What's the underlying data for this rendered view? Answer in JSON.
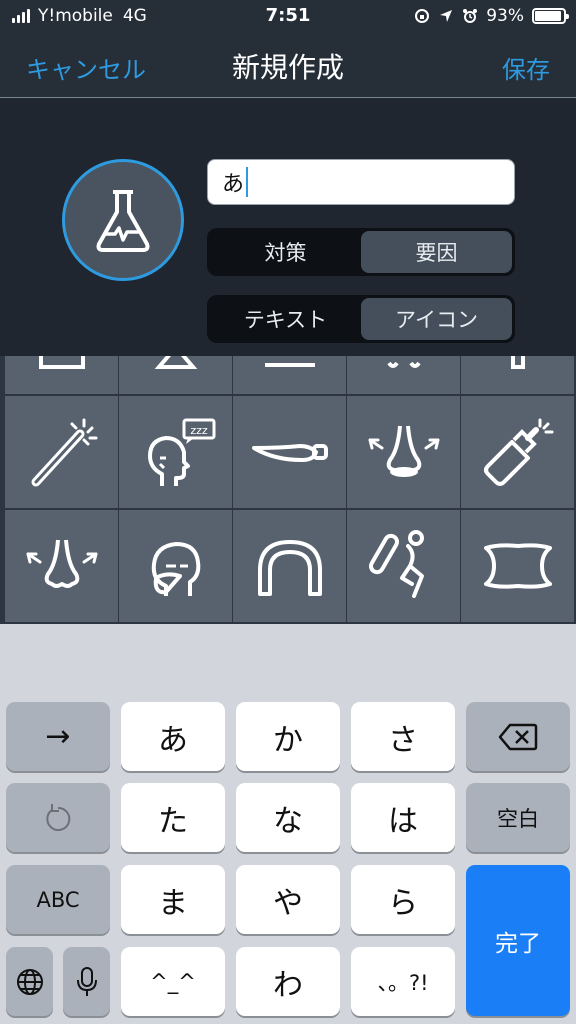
{
  "status_bar": {
    "carrier": "Y!mobile",
    "network": "4G",
    "time": "7:51",
    "battery": "93%",
    "battery_level": 0.93
  },
  "nav": {
    "cancel_label": "キャンセル",
    "title": "新規作成",
    "save_label": "保存"
  },
  "editor": {
    "avatar_icon": "flask-icon",
    "name_value": "あ",
    "segment_type": {
      "options": [
        "対策",
        "要因"
      ],
      "selected": "要因"
    },
    "segment_mode": {
      "options": [
        "テキスト",
        "アイコン"
      ],
      "selected": "アイコン"
    }
  },
  "icon_grid": {
    "rows": [
      [
        "partial-icon",
        "partial-icon",
        "partial-icon",
        "partial-icon",
        "partial-icon"
      ],
      [
        "magic-wand-icon",
        "sleeping-head-icon",
        "pepper-icon",
        "nose-breath-icon",
        "nasal-spray-icon"
      ],
      [
        "nose-icon",
        "mask-face-icon",
        "mouthguard-icon",
        "pillow-exercise-icon",
        "pillow-icon"
      ]
    ]
  },
  "keyboard": {
    "row1": [
      "→",
      "あ",
      "か",
      "さ",
      "delete-icon"
    ],
    "row2": [
      "undo-icon",
      "た",
      "な",
      "は",
      "空白"
    ],
    "row3": [
      "ABC",
      "ま",
      "や",
      "ら"
    ],
    "row4": [
      "globe-icon",
      "mic-icon",
      "^_^",
      "わ",
      "、。?!"
    ],
    "done_label": "完了"
  },
  "colors": {
    "accent": "#2e9be0",
    "nav_bg": "#262e38",
    "grid_cell": "#58626e",
    "done_key": "#1a7ef7"
  }
}
